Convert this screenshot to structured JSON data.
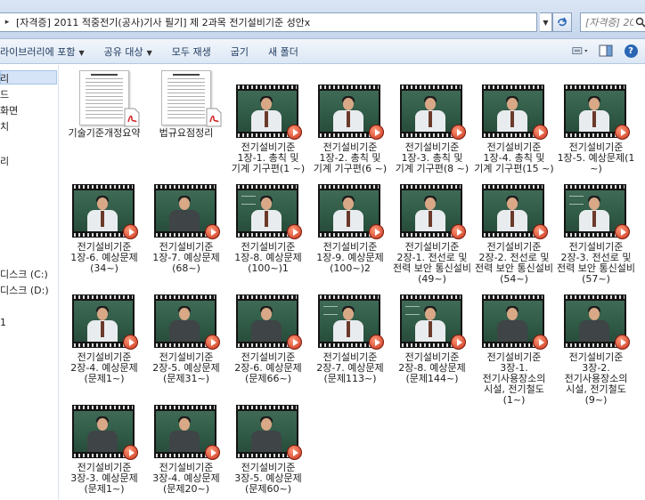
{
  "address_bar": {
    "path": "[자격증] 2011 적중전기(공사)기사 필기] 제 2과목 전기설비기준 성안x",
    "search_placeholder": "[자격증] 201..."
  },
  "toolbar": {
    "library": "라이브러리에 포함",
    "share": "공유 대상",
    "play_all": "모두 재생",
    "burn": "굽기",
    "new_folder": "새 폴더"
  },
  "nav": {
    "items": [
      {
        "label": "리"
      },
      {
        "label": "드"
      },
      {
        "label": "화면"
      },
      {
        "label": "치"
      },
      {
        "label": "리"
      },
      {
        "label": "디스크 (C:)"
      },
      {
        "label": "디스크 (D:)"
      },
      {
        "label": "1"
      }
    ]
  },
  "files": [
    {
      "label": "기술기준개정요약",
      "kind": "pdf"
    },
    {
      "label": "법규요점정리",
      "kind": "pdf"
    },
    {
      "label": "전기설비기준 1장-1. 총칙 및 기계 기구편(1 ~)",
      "kind": "video"
    },
    {
      "label": "전기설비기준 1장-2. 총칙 및 기계 기구편(6 ~)",
      "kind": "video"
    },
    {
      "label": "전기설비기준 1장-3. 총칙 및 기계 기구편(8 ~)",
      "kind": "video"
    },
    {
      "label": "전기설비기준 1장-4. 총칙 및 기계 기구편(15 ~)",
      "kind": "video"
    },
    {
      "label": "전기설비기준 1장-5. 예상문제(1 ~)",
      "kind": "video"
    },
    {
      "label": "전기설비기준 1장-6. 예상문제(34~)",
      "kind": "video"
    },
    {
      "label": "전기설비기준 1장-7. 예상문제(68~)",
      "kind": "video"
    },
    {
      "label": "전기설비기준 1장-8. 예상문제(100~)1",
      "kind": "video"
    },
    {
      "label": "전기설비기준 1장-9. 예상문제(100~)2",
      "kind": "video"
    },
    {
      "label": "전기설비기준 2장-1. 전선로 및 전력 보안 통신설비(49~)",
      "kind": "video"
    },
    {
      "label": "전기설비기준 2장-2. 전선로 및 전력 보안 통신설비(54~)",
      "kind": "video"
    },
    {
      "label": "전기설비기준 2장-3. 전선로 및 전력 보안 통신설비(57~)",
      "kind": "video"
    },
    {
      "label": "전기설비기준 2장-4. 예상문제(문제1~)",
      "kind": "video"
    },
    {
      "label": "전기설비기준 2장-5. 예상문제(문제31~)",
      "kind": "video"
    },
    {
      "label": "전기설비기준 2장-6. 예상문제(문제66~)",
      "kind": "video"
    },
    {
      "label": "전기설비기준 2장-7. 예상문제(문제113~)",
      "kind": "video"
    },
    {
      "label": "전기설비기준 2장-8. 예상문제(문제144~)",
      "kind": "video"
    },
    {
      "label": "전기설비기준 3장-1. 전기사용장소의 시설, 전기철도(1~)",
      "kind": "video"
    },
    {
      "label": "전기설비기준 3장-2. 전기사용장소의 시설, 전기철도(9~)",
      "kind": "video"
    },
    {
      "label": "전기설비기준 3장-3. 예상문제(문제1~)",
      "kind": "video"
    },
    {
      "label": "전기설비기준 3장-4. 예상문제(문제20~)",
      "kind": "video"
    },
    {
      "label": "전기설비기준 3장-5. 예상문제(문제60~)",
      "kind": "video"
    }
  ]
}
